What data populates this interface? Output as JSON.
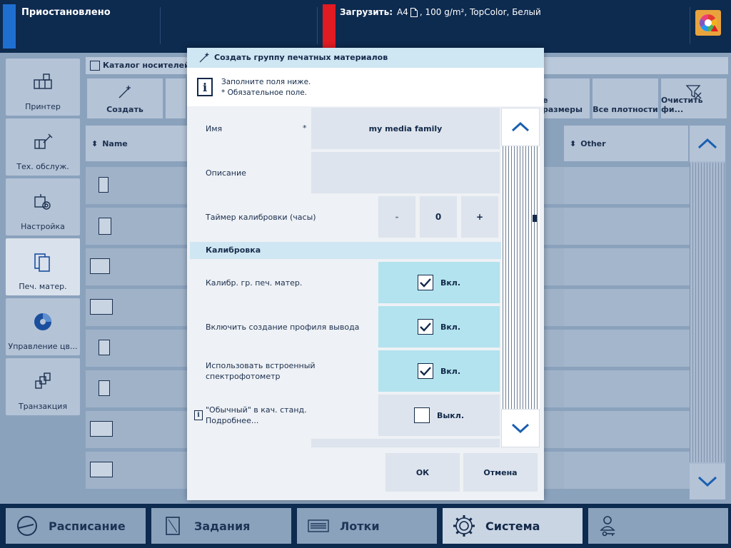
{
  "top": {
    "status": "Приостановлено",
    "load_label": "Загрузить:",
    "load_size": "A4",
    "load_details": ", 100 g/m², TopColor, Белый",
    "app_icon": "color-wheel-warning-icon"
  },
  "sidebar": {
    "items": [
      {
        "label": "Принтер",
        "icon": "printer-icon"
      },
      {
        "label": "Тех. обслуж.",
        "icon": "maintenance-icon"
      },
      {
        "label": "Настройка",
        "icon": "settings-icon"
      },
      {
        "label": "Печ. матер.",
        "icon": "media-icon"
      },
      {
        "label": "Управление цв...",
        "icon": "color-management-icon"
      },
      {
        "label": "Транзакция",
        "icon": "transaction-icon"
      }
    ]
  },
  "catalog": {
    "title": "Каталог носителей (",
    "create_label": "Создать",
    "sizes_label": "е размеры",
    "weights_label": "Все плотности",
    "clear_filter_label": "Очистить фи...",
    "col_name": "Name",
    "col_other": "Other"
  },
  "modal": {
    "title": "Создать группу печатных материалов",
    "info_line1": "Заполните поля ниже.",
    "info_line2": "* Обязательное поле.",
    "name_label": "Имя",
    "required_mark": "*",
    "name_value": "my media family",
    "description_label": "Описание",
    "description_value": "",
    "timer_label": "Таймер калибровки (часы)",
    "timer_minus": "-",
    "timer_value": "0",
    "timer_plus": "+",
    "section_calibration": "Калибровка",
    "calib_group_label": "Калибр. гр. печ. матер.",
    "calib_group_state": "Вкл.",
    "output_profile_label": "Включить создание профиля вывода",
    "output_profile_state": "Вкл.",
    "spectro_label_1": "Использовать встроенный",
    "spectro_label_2": "спектрофотометр",
    "spectro_state": "Вкл.",
    "normal_default_label_1": "\"Обычный\" в кач. станд.",
    "normal_default_label_2": "Подробнее...",
    "normal_default_state": "Выкл.",
    "ok_label": "ОК",
    "cancel_label": "Отмена"
  },
  "bottom": {
    "tabs": [
      {
        "label": "Расписание",
        "icon": "schedule-icon"
      },
      {
        "label": "Задания",
        "icon": "jobs-icon"
      },
      {
        "label": "Лотки",
        "icon": "trays-icon"
      },
      {
        "label": "Система",
        "icon": "system-gear-icon",
        "active": true
      },
      {
        "label": "",
        "icon": "user-key-icon"
      }
    ]
  },
  "colors": {
    "accent_blue": "#1f6fd1",
    "alert_red": "#e01b22",
    "toggle_on_bg": "#b2e3ee",
    "navy": "#0d2a4f"
  }
}
